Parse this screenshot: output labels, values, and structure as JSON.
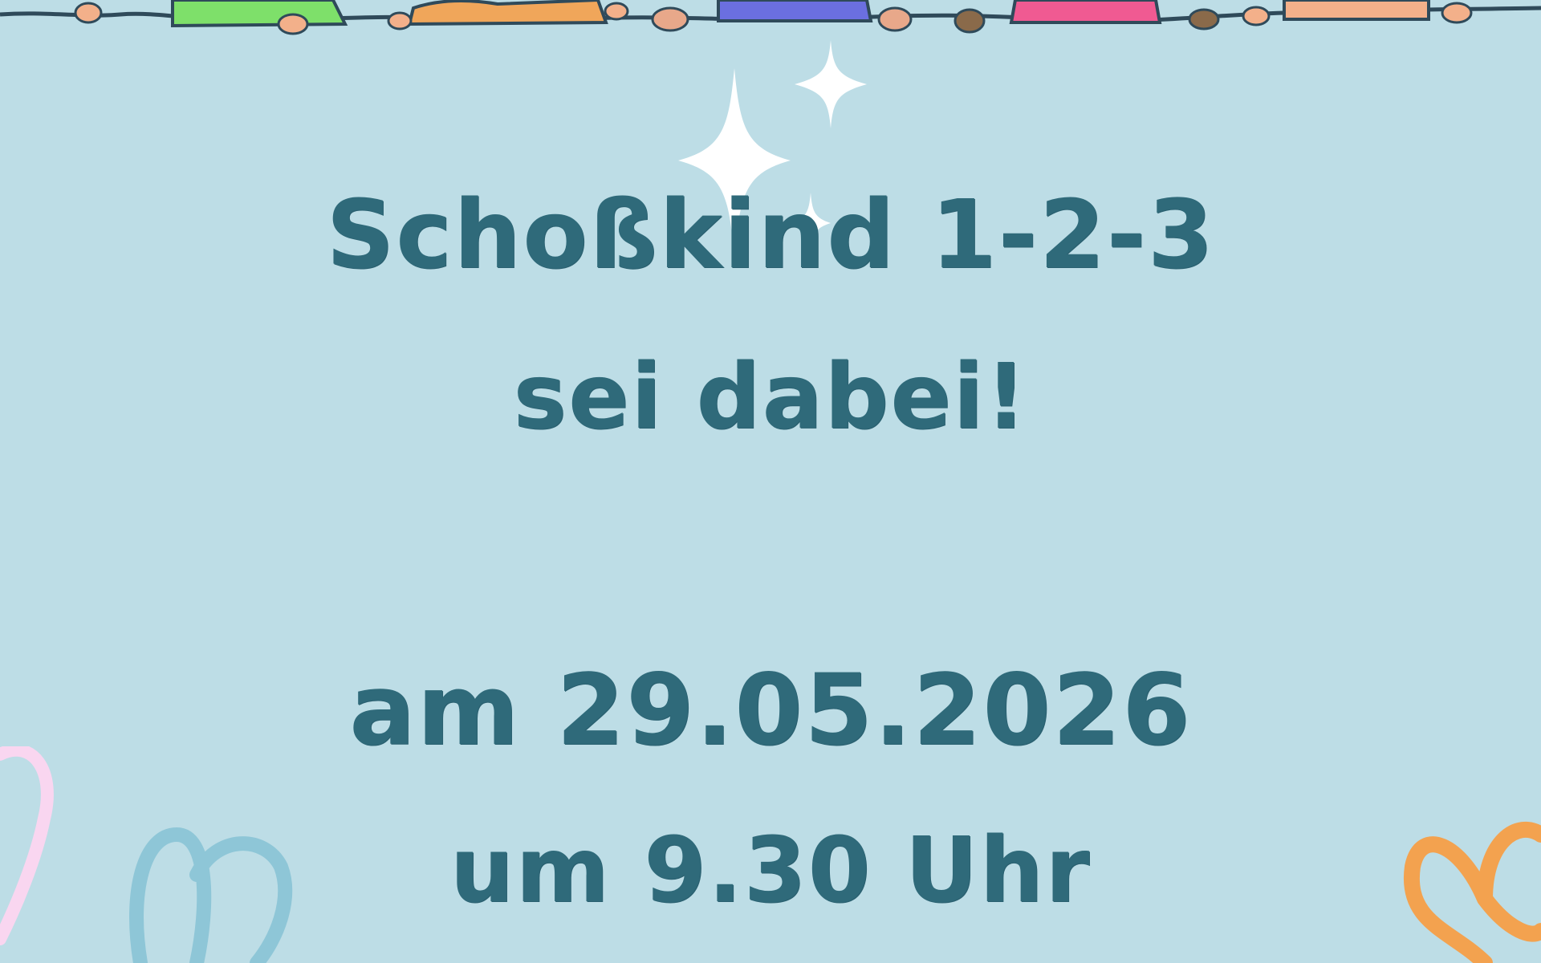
{
  "flyer": {
    "title": "Schoßkind 1-2-3",
    "subtitle": "sei dabei!",
    "date_line": "am 29.05.2026",
    "time_line": "um 9.30 Uhr"
  },
  "colors": {
    "background": "#bddde6",
    "text": "#2f6a7a",
    "sparkle": "#ffffff",
    "green": "#7ee06a",
    "orange": "#f0a65a",
    "blue": "#6b6fe0",
    "pink": "#f05a92",
    "peach": "#f3b08a",
    "light_blue": "#8ec6d7",
    "light_pink": "#f9d6f0",
    "butterfly_orange": "#f3a24f"
  },
  "icons": [
    "children-holding-hands-illustration",
    "sparkle-icon",
    "pink-heart-doodle",
    "blue-loop-doodle",
    "orange-flower-doodle"
  ]
}
